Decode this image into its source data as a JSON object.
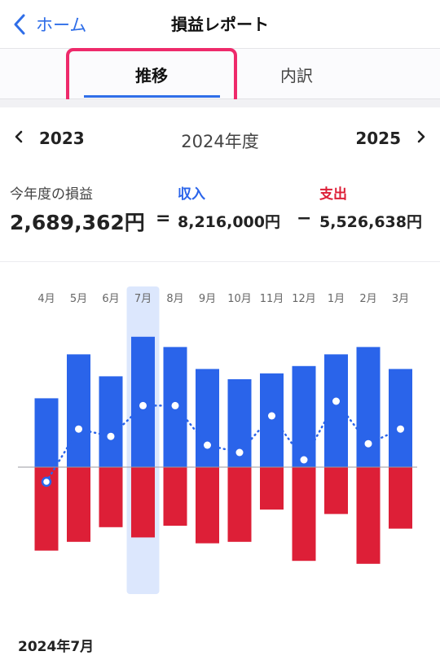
{
  "nav": {
    "back_label": "ホーム",
    "title": "損益レポート"
  },
  "tabs": [
    {
      "label": "推移",
      "active": true
    },
    {
      "label": "内訳",
      "active": false
    }
  ],
  "year_nav": {
    "prev": "2023",
    "current": "2024年度",
    "next": "2025"
  },
  "summary": {
    "profit_label": "今年度の損益",
    "profit_value": "2,689,362円",
    "eq": "=",
    "income_label": "収入",
    "income_value": "8,216,000円",
    "minus": "−",
    "expense_label": "支出",
    "expense_value": "5,526,638円"
  },
  "colors": {
    "income": "#2a64ea",
    "expense": "#dd1f37",
    "accent": "#2f6ee8",
    "selected": "#dce7fd",
    "tab_highlight": "#ee2a6b"
  },
  "chart_data": {
    "type": "bar",
    "categories": [
      "4月",
      "5月",
      "6月",
      "7月",
      "8月",
      "9月",
      "10月",
      "11月",
      "12月",
      "1月",
      "2月",
      "3月"
    ],
    "series": [
      {
        "name": "収入",
        "values": [
          470000,
          770000,
          620000,
          890000,
          820000,
          670000,
          600000,
          640000,
          690000,
          770000,
          820000,
          670000
        ]
      },
      {
        "name": "支出",
        "values": [
          -570000,
          -510000,
          -410000,
          -480000,
          -400000,
          -520000,
          -510000,
          -290000,
          -640000,
          -320000,
          -660000,
          -420000
        ]
      },
      {
        "name": "損益",
        "values": [
          -100000,
          260000,
          210000,
          420000,
          420000,
          150000,
          100000,
          350000,
          50000,
          450000,
          160000,
          260000
        ]
      }
    ],
    "selected_category": "7月",
    "ylim": [
      -800000,
      1000000
    ],
    "grid": false,
    "legend": "none"
  },
  "detail": {
    "title": "2024年7月"
  }
}
